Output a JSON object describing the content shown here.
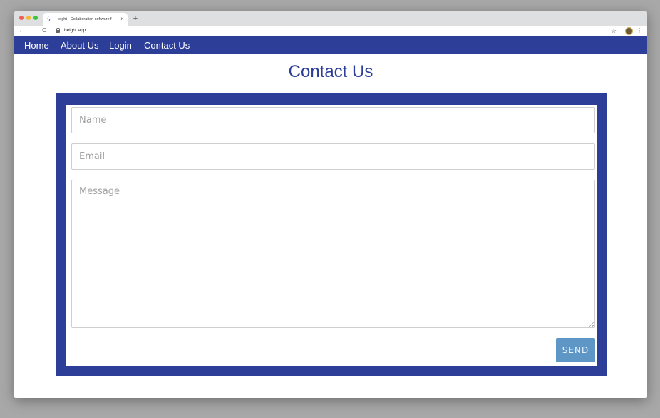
{
  "browser": {
    "tab_title": "Height - Collaboration software f",
    "tab_favicon_glyph": "ϟ",
    "close_glyph": "×",
    "new_tab_glyph": "+",
    "back_glyph": "←",
    "forward_glyph": "→",
    "reload_glyph": "C",
    "url": "height.app",
    "bookmark_glyph": "☆",
    "menu_glyph": "⋮"
  },
  "nav": {
    "items": [
      {
        "label": "Home"
      },
      {
        "label": "About Us"
      },
      {
        "label": "Login"
      },
      {
        "label": "Contact Us"
      }
    ]
  },
  "page": {
    "title": "Contact Us"
  },
  "form": {
    "name_placeholder": "Name",
    "email_placeholder": "Email",
    "message_placeholder": "Message",
    "send_label": "SEND"
  },
  "colors": {
    "brand": "#2c3e97",
    "send_button": "#5e97c6",
    "page_bg": "#ffffff"
  }
}
